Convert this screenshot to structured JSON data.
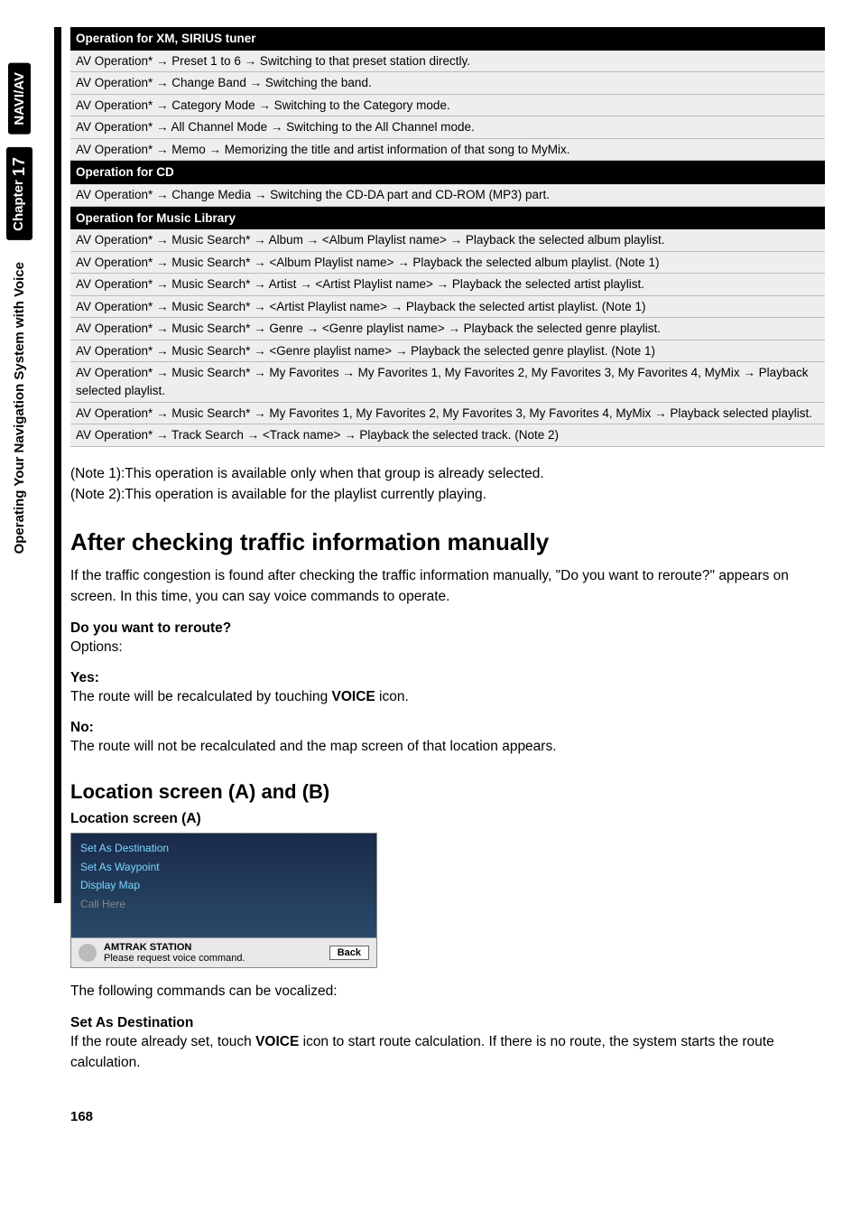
{
  "sidebar": {
    "tab1": "NAVI/AV",
    "tab2_prefix": "Chapter",
    "tab2_num": "17",
    "tab3": "Operating Your Navigation System with Voice"
  },
  "tables": {
    "xm": {
      "header": "Operation for XM, SIRIUS tuner",
      "rows": [
        "AV Operation* → Preset 1 to 6 → Switching to that preset station directly.",
        "AV Operation* → Change Band → Switching the band.",
        "AV Operation* → Category Mode → Switching to the Category mode.",
        "AV Operation* → All Channel Mode → Switching to the All Channel mode.",
        "AV Operation* → Memo → Memorizing the title and artist information of that song to MyMix."
      ]
    },
    "cd": {
      "header": "Operation for CD",
      "rows": [
        "AV Operation* → Change Media → Switching the CD-DA part and CD-ROM (MP3) part."
      ]
    },
    "ml": {
      "header": "Operation for Music Library",
      "rows": [
        "AV Operation* → Music Search* → Album → <Album Playlist name> → Playback the selected album playlist.",
        "AV Operation* → Music Search* → <Album Playlist name> → Playback the selected album playlist. (Note 1)",
        "AV Operation* → Music Search* → Artist → <Artist Playlist name> → Playback the selected artist playlist.",
        "AV Operation* → Music Search* → <Artist Playlist name> → Playback the selected artist playlist. (Note 1)",
        "AV Operation* → Music Search* → Genre → <Genre playlist name> → Playback the selected genre playlist.",
        "AV Operation* → Music Search* → <Genre playlist name> → Playback the selected genre playlist. (Note 1)",
        "AV Operation* → Music Search* → My Favorites → My Favorites 1, My Favorites 2, My Favorites 3, My Favorites 4, MyMix → Playback selected playlist.",
        "AV Operation* → Music Search* → My Favorites 1, My Favorites 2, My Favorites 3, My Favorites 4, MyMix → Playback selected playlist.",
        "AV Operation* → Track Search → <Track name> → Playback the selected track. (Note 2)"
      ]
    }
  },
  "notes": {
    "n1": "(Note 1):This operation is available only when that group is already selected.",
    "n2": "(Note 2):This operation is available for the playlist currently playing."
  },
  "traffic": {
    "heading": "After checking traffic information manually",
    "intro": "If the traffic congestion is found after checking the traffic information manually, \"Do you want to reroute?\" appears on screen. In this time, you can say voice commands to operate.",
    "q_label": "Do you want to reroute?",
    "q_sub": "Options:",
    "yes_label": "Yes:",
    "yes_text_a": "The route will be recalculated by touching ",
    "yes_text_b": "VOICE",
    "yes_text_c": " icon.",
    "no_label": "No:",
    "no_text": "The route will not be recalculated and the map screen of that location appears."
  },
  "location": {
    "heading": "Location screen (A) and (B)",
    "sub": "Location screen (A)",
    "shot": {
      "l1": "Set As Destination",
      "l2": "Set As Waypoint",
      "l3": "Display Map",
      "l4": "Call Here",
      "stn": "AMTRAK STATION",
      "hint": "Please request voice command.",
      "back": "Back"
    },
    "after_shot": "The following commands can be vocalized:",
    "dest_label": "Set As Destination",
    "dest_text_a": "If the route already set, touch ",
    "dest_text_b": "VOICE",
    "dest_text_c": " icon to start route calculation. If there is no route, the system starts the route calculation."
  },
  "page": "168"
}
